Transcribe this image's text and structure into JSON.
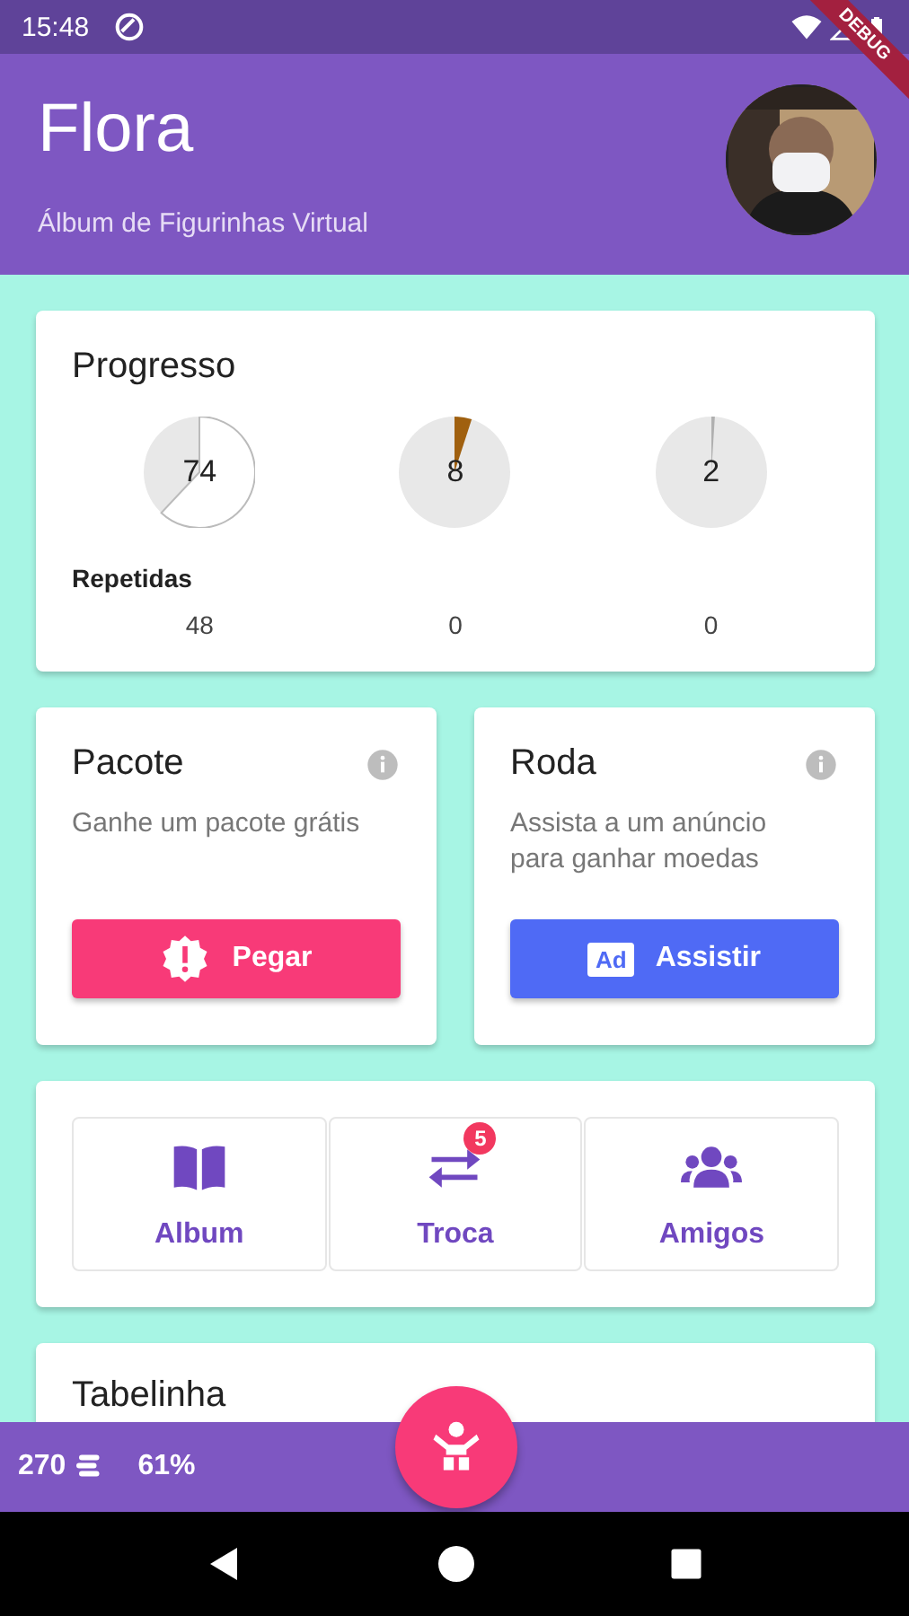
{
  "status_bar": {
    "time": "15:48"
  },
  "debug_banner": "DEBUG",
  "header": {
    "title": "Flora",
    "subtitle": "Álbum de Figurinhas Virtual"
  },
  "progress": {
    "title": "Progresso",
    "pies": [
      {
        "label": "74",
        "color": "#ffffff"
      },
      {
        "label": "8",
        "color": "#a0600f"
      },
      {
        "label": "2",
        "color": "#b0b0b0"
      }
    ],
    "repeated_label": "Repetidas",
    "repeated": [
      "48",
      "0",
      "0"
    ]
  },
  "offers": [
    {
      "title": "Pacote",
      "text": "Ganhe um pacote grátis",
      "button": "Pegar",
      "kind": "gift"
    },
    {
      "title": "Roda",
      "text": "Assista a um anúncio para ganhar moedas",
      "button": "Assistir",
      "kind": "ad",
      "badge": "Ad"
    }
  ],
  "menu": [
    {
      "label": "Album",
      "kind": "book"
    },
    {
      "label": "Troca",
      "kind": "swap",
      "badge": "5"
    },
    {
      "label": "Amigos",
      "kind": "people"
    }
  ],
  "next_card": {
    "title": "Tabelinha"
  },
  "bottom_bar": {
    "coins": "270",
    "percent": "61%"
  }
}
